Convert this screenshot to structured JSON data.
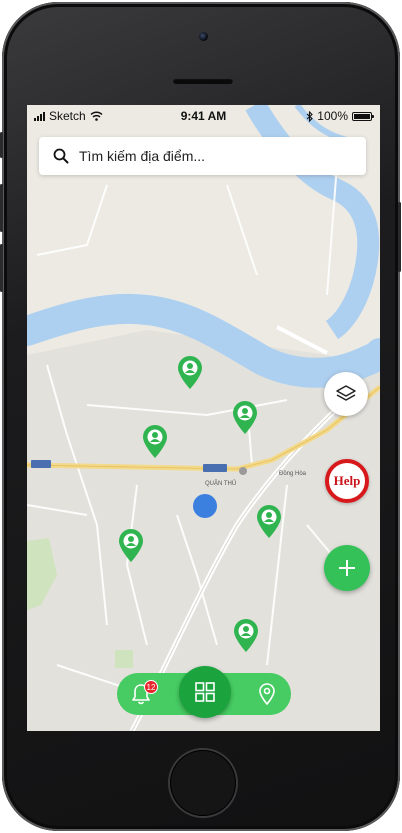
{
  "status_bar": {
    "carrier": "Sketch",
    "time": "9:41 AM",
    "battery": "100%",
    "battery_level": 1.0
  },
  "search": {
    "placeholder": "Tìm kiếm địa điểm..."
  },
  "map": {
    "labels": [
      "QUẬN THỦ",
      "Đồng Hòa",
      "Help"
    ],
    "icons": {
      "location_markers": "person-pin-icon",
      "my_location": "blue-dot-icon",
      "layers": "layers-icon",
      "add": "plus-icon"
    }
  },
  "help_button": {
    "label": "Help"
  },
  "bottom_nav": {
    "notification_count": "12",
    "icons": [
      "bell-icon",
      "grid-icon",
      "location-pin-icon"
    ]
  },
  "colors": {
    "river": "#aed0f0",
    "main_road": "#f3d98a",
    "marker_green": "#2fb44f",
    "nav_green": "#46cc62",
    "nav_center": "#1ba33e",
    "help_red": "#d7191c",
    "my_location": "#3b7fdf"
  }
}
